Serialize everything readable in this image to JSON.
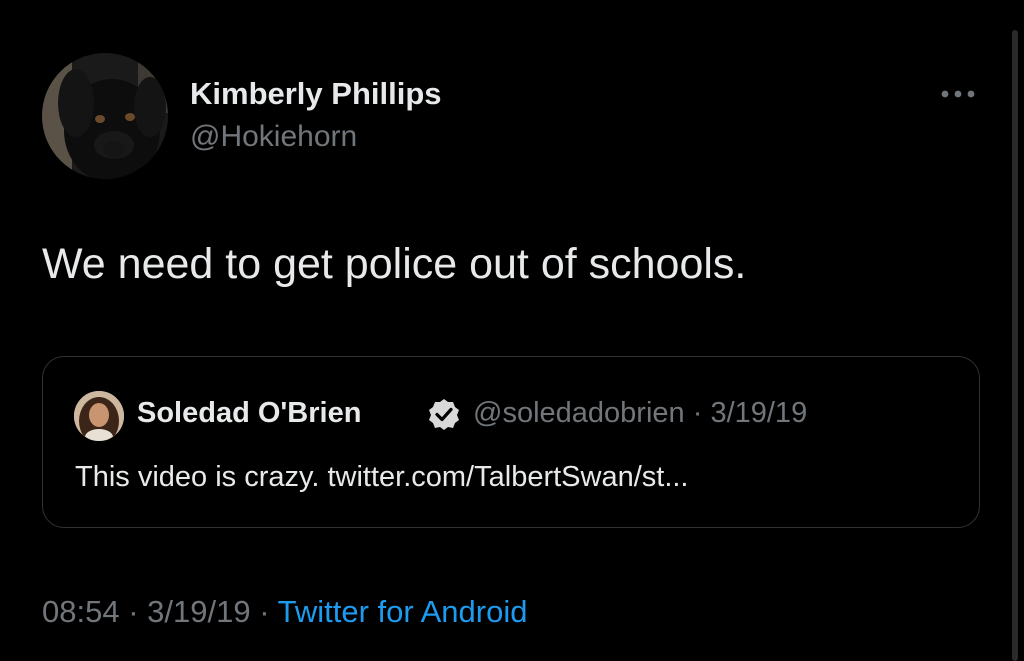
{
  "tweet": {
    "author_name": "Kimberly Phillips",
    "author_handle": "@Hokiehorn",
    "text": "We need to get police out of schools.",
    "time": "08:54",
    "date": "3/19/19",
    "separator": "·",
    "source": "Twitter for Android"
  },
  "quote": {
    "author_name": "Soledad O'Brien",
    "author_handle": "@soledadobrien",
    "separator": "·",
    "date": "3/19/19",
    "text": "This video is crazy. twitter.com/TalbertSwan/st..."
  },
  "icons": {
    "more": "more-horizontal-icon",
    "verified": "verified-badge-icon"
  },
  "colors": {
    "background": "#000000",
    "text_primary": "#e7e9ea",
    "text_secondary": "#71767b",
    "link": "#1d9bf0",
    "border": "#2f3336"
  }
}
